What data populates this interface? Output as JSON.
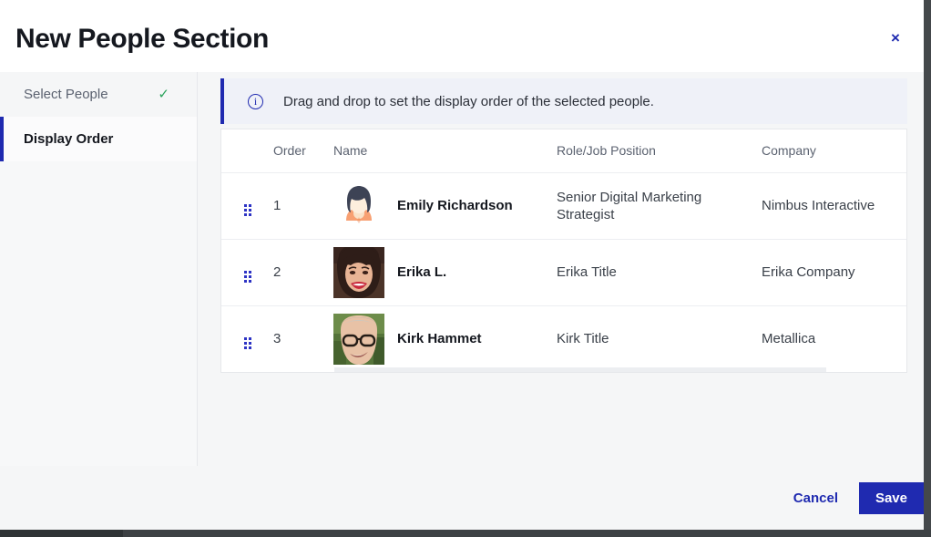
{
  "modal": {
    "title": "New People Section",
    "close_label": "×"
  },
  "sidebar": {
    "items": [
      {
        "label": "Select People",
        "state": "completed",
        "icon": "check-icon",
        "check": "✓"
      },
      {
        "label": "Display Order",
        "state": "active",
        "icon": "",
        "check": ""
      }
    ]
  },
  "banner": {
    "icon": "info-icon",
    "icon_glyph": "i",
    "text": "Drag and drop to set the display order of the selected people."
  },
  "table": {
    "columns": [
      "",
      "Order",
      "Name",
      "Role/Job Position",
      "Company"
    ],
    "rows": [
      {
        "order": "1",
        "name": "Emily Richardson",
        "role": "Senior Digital Marketing Strategist",
        "company": "Nimbus Interactive",
        "avatar": "illustrated-female-avatar"
      },
      {
        "order": "2",
        "name": "Erika L.",
        "role": "Erika Title",
        "company": "Erika Company",
        "avatar": "photo-smiling-woman"
      },
      {
        "order": "3",
        "name": "Kirk Hammet",
        "role": "Kirk Title",
        "company": "Metallica",
        "avatar": "photo-man-glasses"
      }
    ]
  },
  "footer": {
    "cancel_label": "Cancel",
    "save_label": "Save"
  },
  "colors": {
    "accent": "#1f2ab0",
    "banner_bg": "#eff1f8",
    "success": "#2aa35b",
    "page_bg": "#f5f6f7",
    "card_bg": "#ffffff"
  }
}
